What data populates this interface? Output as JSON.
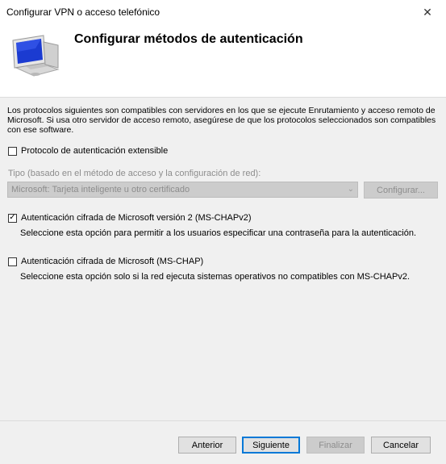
{
  "window": {
    "title": "Configurar VPN o acceso telefónico",
    "close_glyph": "✕"
  },
  "header": {
    "title": "Configurar métodos de autenticación",
    "icon": "computer-monitor-icon"
  },
  "intro": "Los protocolos siguientes son compatibles con servidores en los que se ejecute Enrutamiento y acceso remoto de Microsoft. Si usa otro servidor de acceso remoto, asegúrese de que los protocolos seleccionados son compatibles con ese software.",
  "eap": {
    "label": "Protocolo de autenticación extensible",
    "checked": false
  },
  "type": {
    "label": "Tipo (basado en el método de acceso y la configuración de red):",
    "selected": "Microsoft: Tarjeta inteligente u otro certificado",
    "configure_label": "Configurar..."
  },
  "mschapv2": {
    "label": "Autenticación cifrada de Microsoft versión 2 (MS-CHAPv2)",
    "checked": true,
    "check_glyph": "✓",
    "description": "Seleccione esta opción para permitir a los usuarios especificar una contraseña para la autenticación."
  },
  "mschap": {
    "label": "Autenticación cifrada de Microsoft (MS-CHAP)",
    "checked": false,
    "description": "Seleccione esta opción solo si la red ejecuta sistemas operativos no compatibles con MS-CHAPv2."
  },
  "footer": {
    "back": "Anterior",
    "next": "Siguiente",
    "finish": "Finalizar",
    "cancel": "Cancelar"
  },
  "colors": {
    "accent": "#0078d7",
    "disabled_text": "#8d8d8d"
  }
}
